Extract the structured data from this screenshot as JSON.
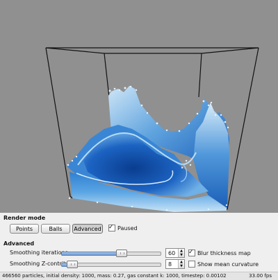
{
  "render_mode": {
    "title": "Render mode",
    "buttons": [
      "Points",
      "Balls",
      "Advanced"
    ],
    "active": "Advanced",
    "paused_label": "Paused",
    "paused_checked": true
  },
  "advanced": {
    "title": "Advanced",
    "smoothing_iterations": {
      "label": "Smoothing iterations",
      "value": "60",
      "slider_fraction": 0.58
    },
    "smoothing_z": {
      "label": "Smoothing Z-contrib",
      "value": "8",
      "slider_fraction": 0.08
    },
    "blur_label": "Blur thickness map",
    "blur_checked": true,
    "curvature_label": "Show mean curvature",
    "curvature_checked": false
  },
  "status": {
    "info": "466560 particles, initial density: 1000, mass: 0.27, gas constant k: 1000, timestep: 0.00102",
    "fps": "33.00 fps"
  },
  "colors": {
    "viewport_bg": "#909090",
    "fluid_deep": "#0a3d8f",
    "fluid_light": "#a8d2f0",
    "foam": "#e6f2fb"
  },
  "icons": {
    "checkbox_tick": "✓",
    "spin_up": "▲",
    "spin_down": "▼"
  }
}
